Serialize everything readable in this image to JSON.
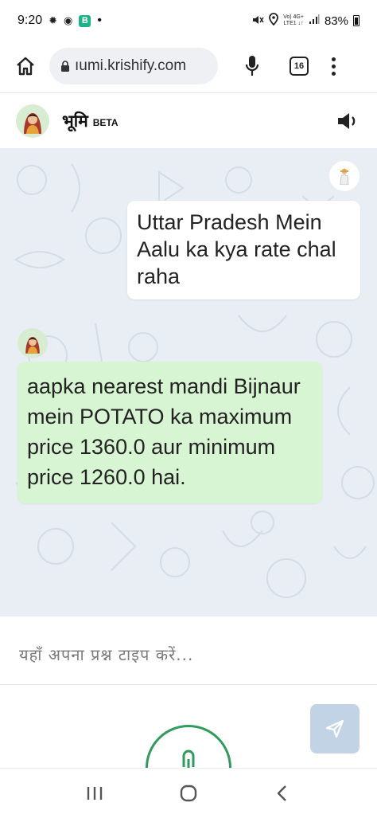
{
  "status_bar": {
    "time": "9:20",
    "app_letter": "B",
    "network_top": "Vo) 4G+",
    "network_bottom": "LTE1 ↓↑",
    "battery": "83%"
  },
  "browser": {
    "url": "ıumi.krishify.com",
    "tab_count": "16"
  },
  "app": {
    "title": "भूमि",
    "badge": "BETA"
  },
  "chat": {
    "messages": [
      {
        "sender": "user",
        "text": "Uttar Pradesh Mein Aalu ka kya rate chal raha"
      },
      {
        "sender": "bot",
        "text": "aapka nearest mandi Bijnaur mein POTATO ka maximum price 1360.0 aur minimum price 1260.0 hai."
      }
    ]
  },
  "input": {
    "placeholder": "यहाँ अपना प्रश्न टाइप करें...",
    "value": ""
  },
  "colors": {
    "chat_background": "#e8eef3",
    "user_bubble": "#ffffff",
    "bot_bubble": "#d8f5d3",
    "send_button": "#c3d3e6",
    "voice_ring": "#2f9b5c"
  }
}
